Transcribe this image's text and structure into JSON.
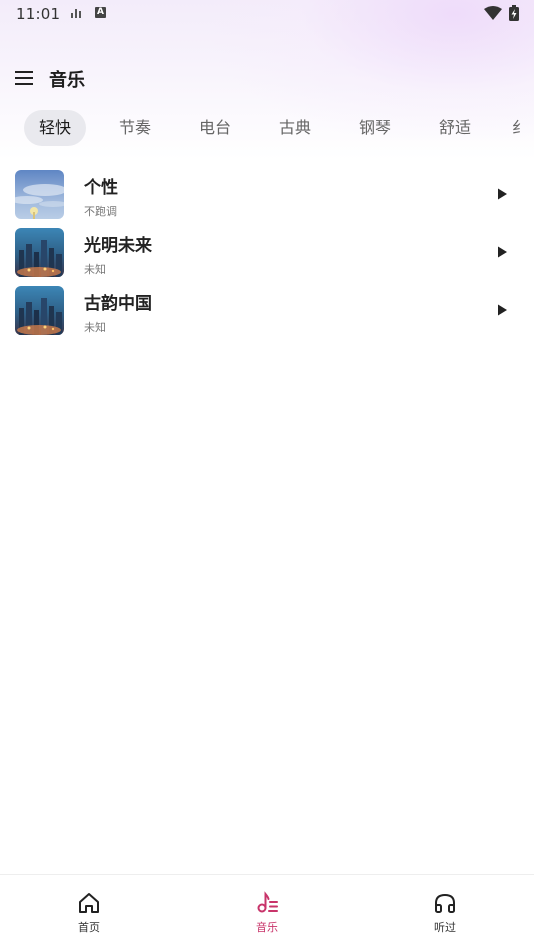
{
  "status_bar": {
    "time": "11:01",
    "indicator_letter": "A"
  },
  "header": {
    "title": "音乐",
    "menu_icon": "hamburger-menu-icon"
  },
  "tabs": [
    {
      "label": "轻快",
      "active": true
    },
    {
      "label": "节奏",
      "active": false
    },
    {
      "label": "电台",
      "active": false
    },
    {
      "label": "古典",
      "active": false
    },
    {
      "label": "钢琴",
      "active": false
    },
    {
      "label": "舒适",
      "active": false
    },
    {
      "label": "纟",
      "active": false
    }
  ],
  "songs": [
    {
      "title": "个性",
      "artist": "不跑调",
      "cover": "sky-cover-icon"
    },
    {
      "title": "光明未来",
      "artist": "未知",
      "cover": "city-night-cover-icon"
    },
    {
      "title": "古韵中国",
      "artist": "未知",
      "cover": "city-night-cover-icon"
    }
  ],
  "bottom_nav": [
    {
      "label": "首页",
      "icon": "home-icon",
      "active": false
    },
    {
      "label": "音乐",
      "icon": "music-list-icon",
      "active": true
    },
    {
      "label": "听过",
      "icon": "headphones-icon",
      "active": false
    }
  ],
  "colors": {
    "accent": "#c8346a",
    "tab_active_bg": "#e9e9ee",
    "text_primary": "#222222",
    "text_secondary": "#777777"
  }
}
